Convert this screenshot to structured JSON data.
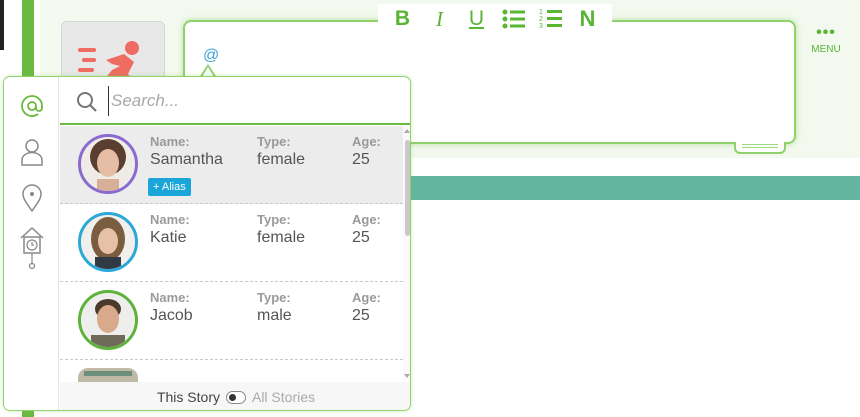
{
  "toolbar": {
    "bold_label": "B",
    "italic_label": "I",
    "underline_label": "U",
    "numbered_label": "N",
    "bullet_icon": "bullet-list-icon",
    "number_icon": "numbered-list-icon"
  },
  "menu": {
    "label": "MENU",
    "dots": "•••"
  },
  "editor": {
    "mention_text": "@"
  },
  "popup": {
    "search": {
      "placeholder": "Search..."
    },
    "tabs": [
      {
        "icon": "at-icon",
        "active": true
      },
      {
        "icon": "person-icon",
        "active": false
      },
      {
        "icon": "location-pin-icon",
        "active": false
      },
      {
        "icon": "cuckoo-clock-icon",
        "active": false
      }
    ],
    "labels": {
      "name": "Name:",
      "type": "Type:",
      "age": "Age:"
    },
    "characters": [
      {
        "name": "Samantha",
        "type": "female",
        "age": "25",
        "alias_label": "+ Alias",
        "ring_color": "#8a6ad0",
        "selected": true
      },
      {
        "name": "Katie",
        "type": "female",
        "age": "25",
        "ring_color": "#2aa8d8",
        "selected": false
      },
      {
        "name": "Jacob",
        "type": "male",
        "age": "25",
        "ring_color": "#5db33a",
        "selected": false
      }
    ],
    "footer": {
      "this_story": "This Story",
      "all_stories": "All Stories"
    }
  },
  "colors": {
    "accent": "#6ab940",
    "teal": "#63b5a0",
    "alias": "#1aa6d9"
  }
}
